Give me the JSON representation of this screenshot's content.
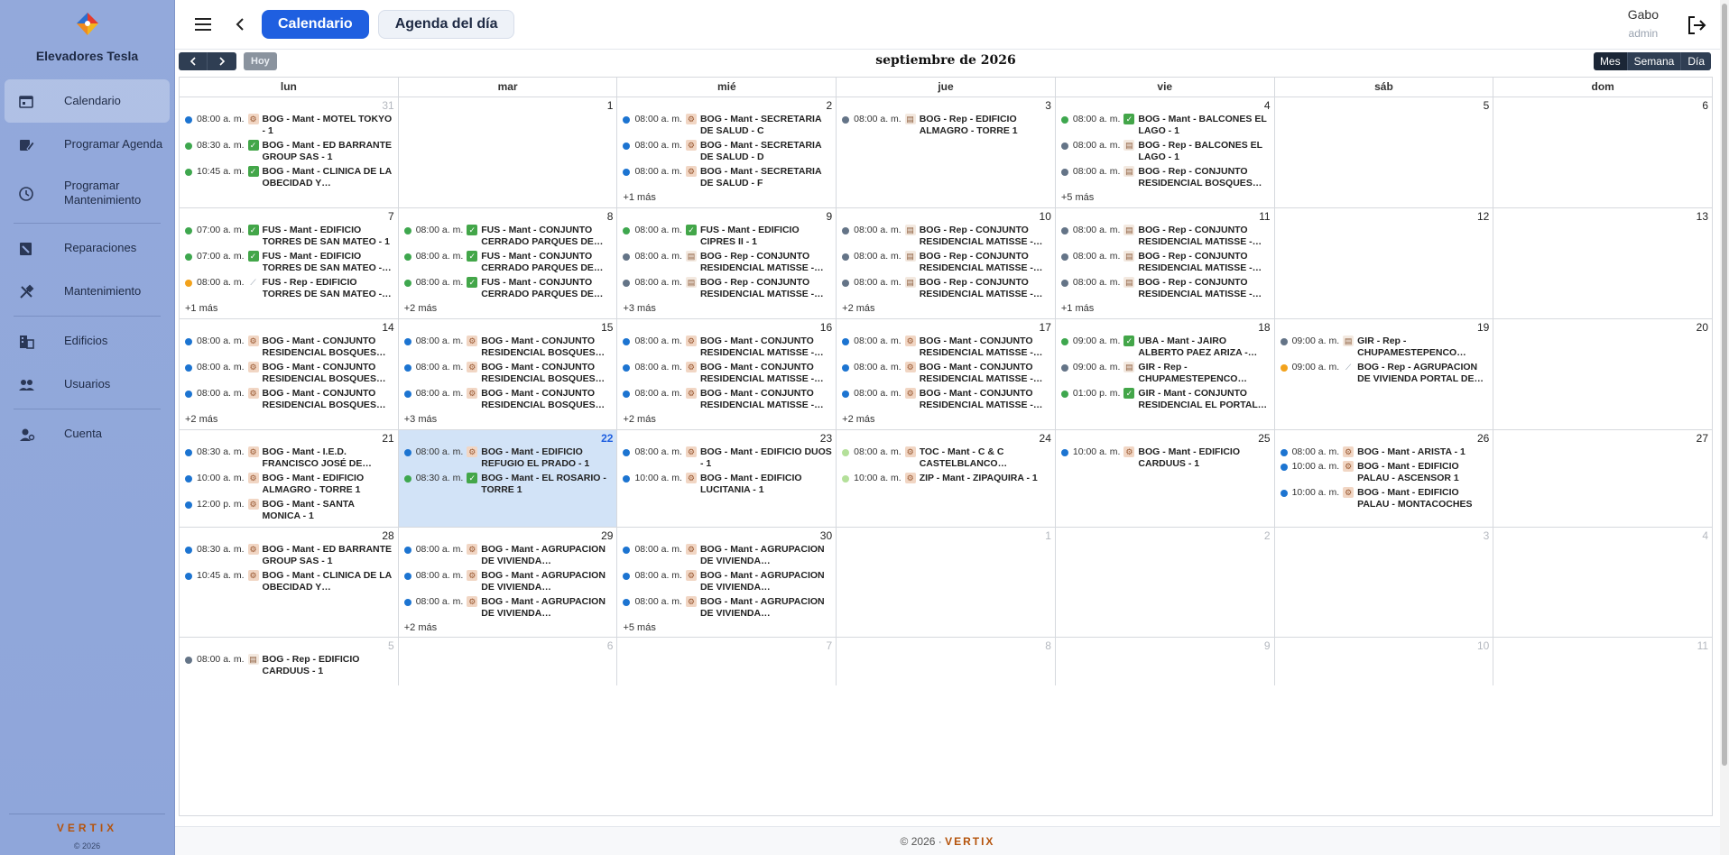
{
  "sidebar": {
    "brand": "Elevadores Tesla",
    "items": [
      {
        "label": "Calendario",
        "icon": "calendar-icon"
      },
      {
        "label": "Programar Agenda",
        "icon": "edit-calendar-icon"
      },
      {
        "label": "Programar Mantenimiento",
        "icon": "maintenance-clock-icon"
      },
      {
        "label": "Reparaciones",
        "icon": "repair-icon"
      },
      {
        "label": "Mantenimiento",
        "icon": "tools-icon"
      },
      {
        "label": "Edificios",
        "icon": "building-icon"
      },
      {
        "label": "Usuarios",
        "icon": "users-icon"
      },
      {
        "label": "Cuenta",
        "icon": "account-icon"
      }
    ],
    "footer_brand": "VERTIX",
    "footer_copy": "© 2026"
  },
  "topbar": {
    "tab_calendar": "Calendario",
    "tab_agenda": "Agenda del día",
    "user_name": "Gabo",
    "user_role": "admin"
  },
  "toolbar": {
    "today": "Hoy",
    "title": "septiembre de 2026",
    "views": [
      "Mes",
      "Semana",
      "Día"
    ]
  },
  "days_of_week": [
    "lun",
    "mar",
    "mié",
    "jue",
    "vie",
    "sáb",
    "dom"
  ],
  "colors": {
    "blue": "#1c74d1",
    "green": "#3ea74e",
    "gray": "#647487",
    "orange": "#f2a21c",
    "lightgreen": "#b4e09a",
    "accent": "#1f5fe0",
    "today_bg": "#d2e3f7"
  },
  "weeks": [
    {
      "days": [
        {
          "n": "31",
          "other": true,
          "events": [
            {
              "c": "blue",
              "t": "08:00 a. m.",
              "k": "mant",
              "x": "BOG - Mant - MOTEL TOKYO - 1"
            },
            {
              "c": "green",
              "t": "08:30 a. m.",
              "k": "ok",
              "x": "BOG - Mant - ED BARRANTE GROUP SAS - 1"
            },
            {
              "c": "green",
              "t": "10:45 a. m.",
              "k": "ok",
              "x": "BOG - Mant - CLINICA DE LA OBECIDAD Y…"
            }
          ]
        },
        {
          "n": "1",
          "events": []
        },
        {
          "n": "2",
          "events": [
            {
              "c": "blue",
              "t": "08:00 a. m.",
              "k": "mant",
              "x": "BOG - Mant - SECRETARIA DE SALUD - C"
            },
            {
              "c": "blue",
              "t": "08:00 a. m.",
              "k": "mant",
              "x": "BOG - Mant - SECRETARIA DE SALUD - D"
            },
            {
              "c": "blue",
              "t": "08:00 a. m.",
              "k": "mant",
              "x": "BOG - Mant - SECRETARIA DE SALUD - F"
            }
          ],
          "more": "+1 más"
        },
        {
          "n": "3",
          "events": [
            {
              "c": "gray",
              "t": "08:00 a. m.",
              "k": "rep",
              "x": "BOG - Rep - EDIFICIO ALMAGRO - TORRE 1"
            }
          ]
        },
        {
          "n": "4",
          "events": [
            {
              "c": "green",
              "t": "08:00 a. m.",
              "k": "ok",
              "x": "BOG - Mant - BALCONES EL LAGO - 1"
            },
            {
              "c": "gray",
              "t": "08:00 a. m.",
              "k": "rep",
              "x": "BOG - Rep - BALCONES EL LAGO - 1"
            },
            {
              "c": "gray",
              "t": "08:00 a. m.",
              "k": "rep",
              "x": "BOG - Rep - CONJUNTO RESIDENCIAL BOSQUES DE…"
            }
          ],
          "more": "+5 más"
        },
        {
          "n": "5",
          "events": []
        },
        {
          "n": "6",
          "events": []
        }
      ]
    },
    {
      "days": [
        {
          "n": "7",
          "events": [
            {
              "c": "green",
              "t": "07:00 a. m.",
              "k": "ok",
              "x": "FUS - Mant - EDIFICIO TORRES DE SAN MATEO - 1"
            },
            {
              "c": "green",
              "t": "07:00 a. m.",
              "k": "ok",
              "x": "FUS - Mant - EDIFICIO TORRES DE SAN MATEO -…"
            },
            {
              "c": "orange",
              "t": "08:00 a. m.",
              "k": "wrench",
              "x": "FUS - Rep - EDIFICIO TORRES DE SAN MATEO -…"
            }
          ],
          "more": "+1 más"
        },
        {
          "n": "8",
          "events": [
            {
              "c": "green",
              "t": "08:00 a. m.",
              "k": "ok",
              "x": "FUS - Mant - CONJUNTO CERRADO PARQUES DE…"
            },
            {
              "c": "green",
              "t": "08:00 a. m.",
              "k": "ok",
              "x": "FUS - Mant - CONJUNTO CERRADO PARQUES DE…"
            },
            {
              "c": "green",
              "t": "08:00 a. m.",
              "k": "ok",
              "x": "FUS - Mant - CONJUNTO CERRADO PARQUES DE…"
            }
          ],
          "more": "+2 más"
        },
        {
          "n": "9",
          "events": [
            {
              "c": "green",
              "t": "08:00 a. m.",
              "k": "ok",
              "x": "FUS - Mant - EDIFICIO CIPRES II - 1"
            },
            {
              "c": "gray",
              "t": "08:00 a. m.",
              "k": "rep",
              "x": "BOG - Rep - CONJUNTO RESIDENCIAL MATISSE -…"
            },
            {
              "c": "gray",
              "t": "08:00 a. m.",
              "k": "rep",
              "x": "BOG - Rep - CONJUNTO RESIDENCIAL MATISSE -…"
            }
          ],
          "more": "+3 más"
        },
        {
          "n": "10",
          "events": [
            {
              "c": "gray",
              "t": "08:00 a. m.",
              "k": "rep",
              "x": "BOG - Rep - CONJUNTO RESIDENCIAL MATISSE -…"
            },
            {
              "c": "gray",
              "t": "08:00 a. m.",
              "k": "rep",
              "x": "BOG - Rep - CONJUNTO RESIDENCIAL MATISSE -…"
            },
            {
              "c": "gray",
              "t": "08:00 a. m.",
              "k": "rep",
              "x": "BOG - Rep - CONJUNTO RESIDENCIAL MATISSE -…"
            }
          ],
          "more": "+2 más"
        },
        {
          "n": "11",
          "events": [
            {
              "c": "gray",
              "t": "08:00 a. m.",
              "k": "rep",
              "x": "BOG - Rep - CONJUNTO RESIDENCIAL MATISSE -…"
            },
            {
              "c": "gray",
              "t": "08:00 a. m.",
              "k": "rep",
              "x": "BOG - Rep - CONJUNTO RESIDENCIAL MATISSE -…"
            },
            {
              "c": "gray",
              "t": "08:00 a. m.",
              "k": "rep",
              "x": "BOG - Rep - CONJUNTO RESIDENCIAL MATISSE -…"
            }
          ],
          "more": "+1 más"
        },
        {
          "n": "12",
          "events": []
        },
        {
          "n": "13",
          "events": []
        }
      ]
    },
    {
      "days": [
        {
          "n": "14",
          "events": [
            {
              "c": "blue",
              "t": "08:00 a. m.",
              "k": "mant",
              "x": "BOG - Mant - CONJUNTO RESIDENCIAL BOSQUES DE…"
            },
            {
              "c": "blue",
              "t": "08:00 a. m.",
              "k": "mant",
              "x": "BOG - Mant - CONJUNTO RESIDENCIAL BOSQUES DE…"
            },
            {
              "c": "blue",
              "t": "08:00 a. m.",
              "k": "mant",
              "x": "BOG - Mant - CONJUNTO RESIDENCIAL BOSQUES DE…"
            }
          ],
          "more": "+2 más"
        },
        {
          "n": "15",
          "events": [
            {
              "c": "blue",
              "t": "08:00 a. m.",
              "k": "mant",
              "x": "BOG - Mant - CONJUNTO RESIDENCIAL BOSQUES DE…"
            },
            {
              "c": "blue",
              "t": "08:00 a. m.",
              "k": "mant",
              "x": "BOG - Mant - CONJUNTO RESIDENCIAL BOSQUES DE…"
            },
            {
              "c": "blue",
              "t": "08:00 a. m.",
              "k": "mant",
              "x": "BOG - Mant - CONJUNTO RESIDENCIAL BOSQUES DE…"
            }
          ],
          "more": "+3 más"
        },
        {
          "n": "16",
          "events": [
            {
              "c": "blue",
              "t": "08:00 a. m.",
              "k": "mant",
              "x": "BOG - Mant - CONJUNTO RESIDENCIAL MATISSE -…"
            },
            {
              "c": "blue",
              "t": "08:00 a. m.",
              "k": "mant",
              "x": "BOG - Mant - CONJUNTO RESIDENCIAL MATISSE -…"
            },
            {
              "c": "blue",
              "t": "08:00 a. m.",
              "k": "mant",
              "x": "BOG - Mant - CONJUNTO RESIDENCIAL MATISSE -…"
            }
          ],
          "more": "+2 más"
        },
        {
          "n": "17",
          "events": [
            {
              "c": "blue",
              "t": "08:00 a. m.",
              "k": "mant",
              "x": "BOG - Mant - CONJUNTO RESIDENCIAL MATISSE -…"
            },
            {
              "c": "blue",
              "t": "08:00 a. m.",
              "k": "mant",
              "x": "BOG - Mant - CONJUNTO RESIDENCIAL MATISSE -…"
            },
            {
              "c": "blue",
              "t": "08:00 a. m.",
              "k": "mant",
              "x": "BOG - Mant - CONJUNTO RESIDENCIAL MATISSE -…"
            }
          ],
          "more": "+2 más"
        },
        {
          "n": "18",
          "events": [
            {
              "c": "green",
              "t": "09:00 a. m.",
              "k": "ok",
              "x": "UBA - Mant - JAIRO ALBERTO PAEZ ARIZA -…"
            },
            {
              "c": "gray",
              "t": "09:00 a. m.",
              "k": "rep",
              "x": "GIR - Rep - CHUPAMESTEPENCO…"
            },
            {
              "c": "green",
              "t": "01:00 p. m.",
              "k": "ok",
              "x": "GIR - Mant - CONJUNTO RESIDENCIAL EL PORTAL D…"
            }
          ]
        },
        {
          "n": "19",
          "events": [
            {
              "c": "gray",
              "t": "09:00 a. m.",
              "k": "rep",
              "x": "GIR - Rep - CHUPAMESTEPENCO…"
            },
            {
              "c": "orange",
              "t": "09:00 a. m.",
              "k": "wrench",
              "x": "BOG - Rep - AGRUPACION DE VIVIENDA PORTAL DE…"
            }
          ]
        },
        {
          "n": "20",
          "events": []
        }
      ]
    },
    {
      "days": [
        {
          "n": "21",
          "events": [
            {
              "c": "blue",
              "t": "08:30 a. m.",
              "k": "mant",
              "x": "BOG - Mant - I.E.D. FRANCISCO JOSÉ DE…"
            },
            {
              "c": "blue",
              "t": "10:00 a. m.",
              "k": "mant",
              "x": "BOG - Mant - EDIFICIO ALMAGRO - TORRE 1"
            },
            {
              "c": "blue",
              "t": "12:00 p. m.",
              "k": "mant",
              "x": "BOG - Mant - SANTA MONICA - 1"
            }
          ]
        },
        {
          "n": "22",
          "today": true,
          "events": [
            {
              "c": "blue",
              "t": "08:00 a. m.",
              "k": "mant",
              "x": "BOG - Mant - EDIFICIO REFUGIO EL PRADO - 1"
            },
            {
              "c": "green",
              "t": "08:30 a. m.",
              "k": "ok",
              "x": "BOG - Mant - EL ROSARIO - TORRE 1"
            }
          ]
        },
        {
          "n": "23",
          "events": [
            {
              "c": "blue",
              "t": "08:00 a. m.",
              "k": "mant",
              "x": "BOG - Mant - EDIFICIO DUOS - 1"
            },
            {
              "c": "blue",
              "t": "10:00 a. m.",
              "k": "mant",
              "x": "BOG - Mant - EDIFICIO LUCITANIA - 1"
            }
          ]
        },
        {
          "n": "24",
          "events": [
            {
              "c": "lightgreen",
              "t": "08:00 a. m.",
              "k": "mant",
              "x": "TOC - Mant - C & C CASTELBLANCO…"
            },
            {
              "c": "lightgreen",
              "t": "10:00 a. m.",
              "k": "mant",
              "x": "ZIP - Mant - ZIPAQUIRA - 1"
            }
          ]
        },
        {
          "n": "25",
          "events": [
            {
              "c": "blue",
              "t": "10:00 a. m.",
              "k": "mant",
              "x": "BOG - Mant - EDIFICIO CARDUUS - 1"
            }
          ]
        },
        {
          "n": "26",
          "events": [
            {
              "c": "blue",
              "t": "08:00 a. m.",
              "k": "mant",
              "x": "BOG - Mant - ARISTA - 1"
            },
            {
              "c": "blue",
              "t": "10:00 a. m.",
              "k": "mant",
              "x": "BOG - Mant - EDIFICIO PALAU - ASCENSOR 1"
            },
            {
              "c": "blue",
              "t": "10:00 a. m.",
              "k": "mant",
              "x": "BOG - Mant - EDIFICIO PALAU - MONTACOCHES"
            }
          ]
        },
        {
          "n": "27",
          "events": []
        }
      ]
    },
    {
      "days": [
        {
          "n": "28",
          "events": [
            {
              "c": "blue",
              "t": "08:30 a. m.",
              "k": "mant",
              "x": "BOG - Mant - ED BARRANTE GROUP SAS - 1"
            },
            {
              "c": "blue",
              "t": "10:45 a. m.",
              "k": "mant",
              "x": "BOG - Mant - CLINICA DE LA OBECIDAD Y…"
            }
          ]
        },
        {
          "n": "29",
          "events": [
            {
              "c": "blue",
              "t": "08:00 a. m.",
              "k": "mant",
              "x": "BOG - Mant - AGRUPACION DE VIVIENDA…"
            },
            {
              "c": "blue",
              "t": "08:00 a. m.",
              "k": "mant",
              "x": "BOG - Mant - AGRUPACION DE VIVIENDA…"
            },
            {
              "c": "blue",
              "t": "08:00 a. m.",
              "k": "mant",
              "x": "BOG - Mant - AGRUPACION DE VIVIENDA…"
            }
          ],
          "more": "+2 más"
        },
        {
          "n": "30",
          "events": [
            {
              "c": "blue",
              "t": "08:00 a. m.",
              "k": "mant",
              "x": "BOG - Mant - AGRUPACION DE VIVIENDA…"
            },
            {
              "c": "blue",
              "t": "08:00 a. m.",
              "k": "mant",
              "x": "BOG - Mant - AGRUPACION DE VIVIENDA…"
            },
            {
              "c": "blue",
              "t": "08:00 a. m.",
              "k": "mant",
              "x": "BOG - Mant - AGRUPACION DE VIVIENDA…"
            }
          ],
          "more": "+5 más"
        },
        {
          "n": "1",
          "other": true,
          "events": []
        },
        {
          "n": "2",
          "other": true,
          "events": []
        },
        {
          "n": "3",
          "other": true,
          "events": []
        },
        {
          "n": "4",
          "other": true,
          "events": []
        }
      ]
    },
    {
      "days": [
        {
          "n": "5",
          "other": true,
          "events": [
            {
              "c": "gray",
              "t": "08:00 a. m.",
              "k": "rep",
              "x": "BOG - Rep - EDIFICIO CARDUUS - 1"
            }
          ]
        },
        {
          "n": "6",
          "other": true,
          "events": []
        },
        {
          "n": "7",
          "other": true,
          "events": []
        },
        {
          "n": "8",
          "other": true,
          "events": []
        },
        {
          "n": "9",
          "other": true,
          "events": []
        },
        {
          "n": "10",
          "other": true,
          "events": []
        },
        {
          "n": "11",
          "other": true,
          "events": []
        }
      ]
    }
  ],
  "footer": {
    "copy": "© 2026 ·",
    "brand": "VERTIX"
  }
}
